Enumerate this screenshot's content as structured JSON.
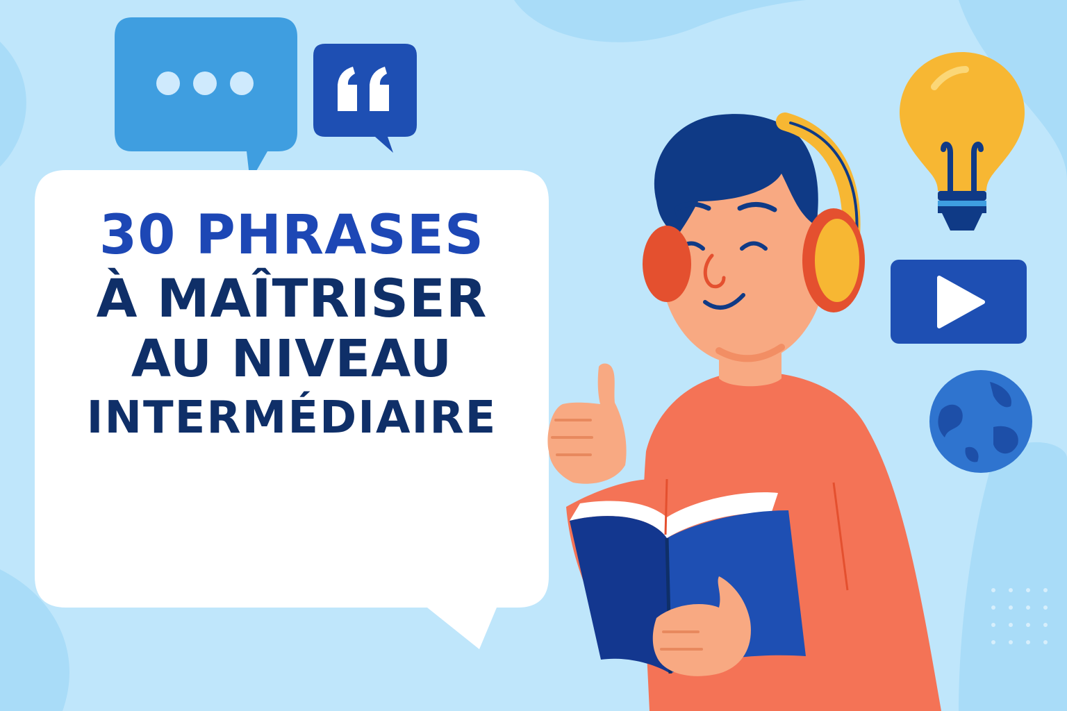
{
  "headline": {
    "line1": "30 PHRASES",
    "line2": "À MAÎTRISER",
    "line3": "AU NIVEAU",
    "line4": "INTERMÉDIAIRE"
  },
  "colors": {
    "background": "#bfe6fb",
    "headline_primary": "#1d47b5",
    "headline_dark": "#0f2f68",
    "chat_bubble": "#3f9ee0",
    "quote_bubble": "#1e4fb3",
    "shirt": "#f47356",
    "hair": "#0f3a86",
    "headphones_yellow": "#f7b733",
    "headphones_red": "#e4502f",
    "book": "#13378f",
    "bulb": "#f7b733",
    "play_button": "#1e4fb3",
    "globe": "#2f74cf"
  },
  "icons": [
    "chat-bubble-icon",
    "quote-icon",
    "lightbulb-icon",
    "play-button-icon",
    "globe-icon"
  ]
}
